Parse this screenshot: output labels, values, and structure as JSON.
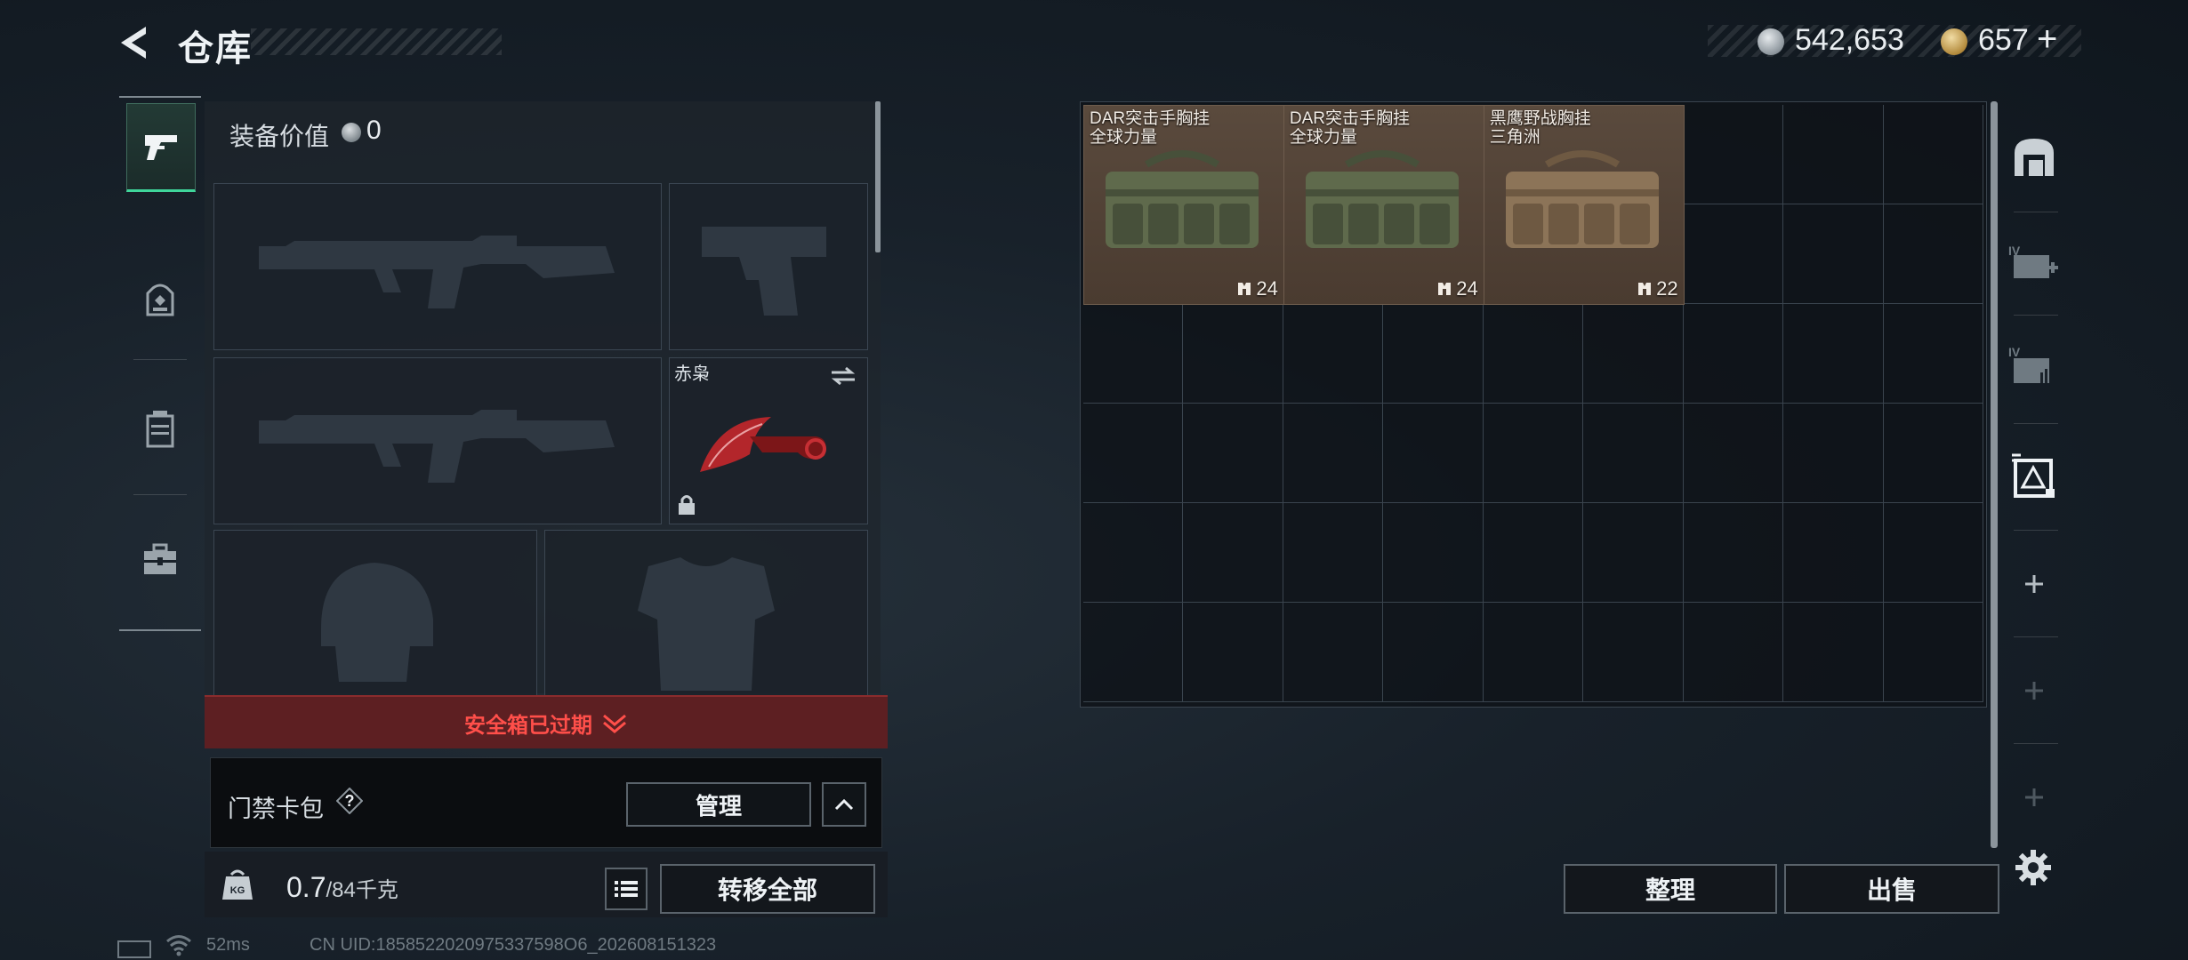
{
  "header": {
    "title": "仓库",
    "currency_silver": "542,653",
    "currency_gold": "657",
    "plus": "+"
  },
  "left_tabs": [
    {
      "name": "weapon-tab",
      "icon": "pistol-icon",
      "active": true
    },
    {
      "name": "gear-tab",
      "icon": "backpack-icon",
      "active": false
    },
    {
      "name": "container-tab",
      "icon": "case-icon",
      "active": false
    },
    {
      "name": "medkit-tab",
      "icon": "toolbox-icon",
      "active": false
    }
  ],
  "loadout": {
    "equip_value_label": "装备价值",
    "equip_value": "0",
    "knife_name": "赤枭",
    "safe_box_expired": "安全箱已过期",
    "keycard_label": "门禁卡包",
    "keycard_help": "?",
    "manage_button": "管理",
    "weight_value": "0.7",
    "weight_max": "/84千克",
    "transfer_all": "转移全部"
  },
  "storage": {
    "items": [
      {
        "name_line1": "DAR突击手胸挂",
        "name_line2": "全球力量",
        "capacity": "24"
      },
      {
        "name_line1": "DAR突击手胸挂",
        "name_line2": "全球力量",
        "capacity": "24"
      },
      {
        "name_line1": "黑鹰野战胸挂",
        "name_line2": "三角洲",
        "capacity": "22"
      }
    ],
    "sort_button": "整理",
    "sell_button": "出售"
  },
  "right_tabs": [
    {
      "name": "storage-tab",
      "icon": "vault-icon"
    },
    {
      "name": "expand-storage-tab",
      "icon": "expand-storage-icon"
    },
    {
      "name": "storage-level-tab",
      "icon": "storage-level-icon"
    },
    {
      "name": "delta-storage-tab",
      "icon": "delta-storage-icon"
    },
    {
      "name": "add-storage-tab",
      "icon": "plus-icon"
    },
    {
      "name": "add-storage-tab-2",
      "icon": "plus-icon"
    },
    {
      "name": "add-storage-tab-3",
      "icon": "plus-icon"
    }
  ],
  "status": {
    "ping": "52ms",
    "uid": "CN UID:1858522020975337598O6_202608151323"
  }
}
